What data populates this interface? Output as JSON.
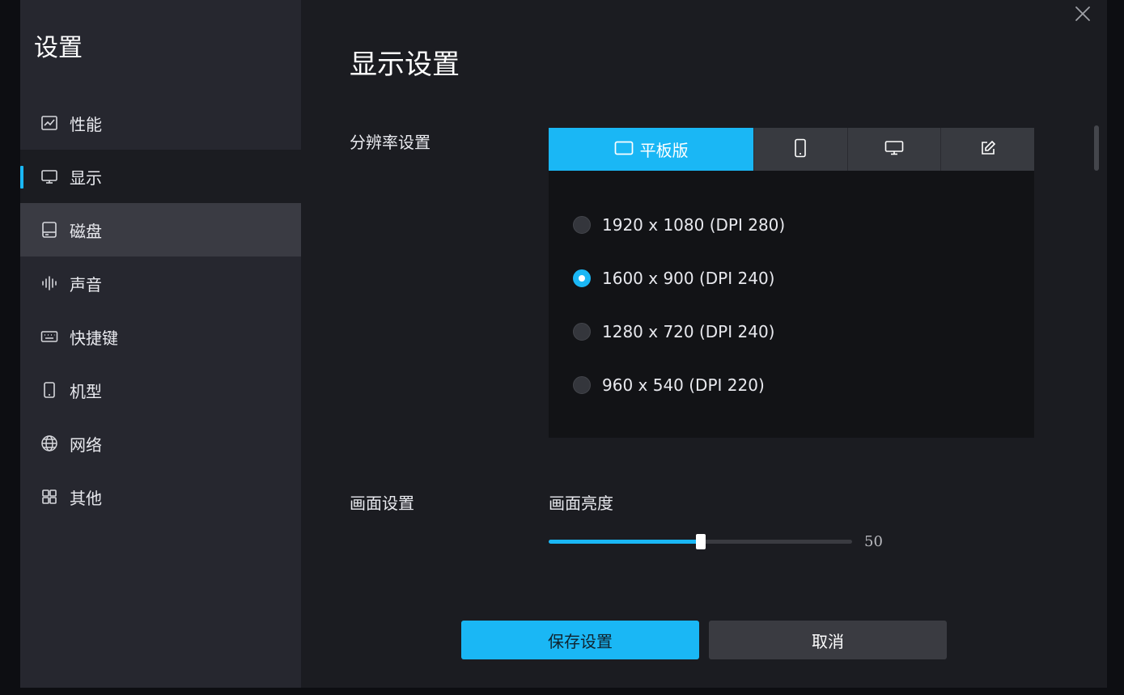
{
  "sidebar": {
    "title": "设置",
    "items": [
      {
        "label": "性能",
        "icon": "chart-line-icon",
        "state": "normal"
      },
      {
        "label": "显示",
        "icon": "monitor-icon",
        "state": "active"
      },
      {
        "label": "磁盘",
        "icon": "disk-icon",
        "state": "hover"
      },
      {
        "label": "声音",
        "icon": "sound-wave-icon",
        "state": "normal"
      },
      {
        "label": "快捷键",
        "icon": "keyboard-icon",
        "state": "normal"
      },
      {
        "label": "机型",
        "icon": "phone-icon",
        "state": "normal"
      },
      {
        "label": "网络",
        "icon": "globe-icon",
        "state": "normal"
      },
      {
        "label": "其他",
        "icon": "grid-icon",
        "state": "normal"
      }
    ]
  },
  "main": {
    "title": "显示设置",
    "resolution": {
      "label": "分辨率设置",
      "tabs": [
        {
          "label": "平板版",
          "icon": "tablet-icon",
          "selected": true
        },
        {
          "label": "",
          "icon": "phone-icon",
          "selected": false
        },
        {
          "label": "",
          "icon": "desktop-icon",
          "selected": false
        },
        {
          "label": "",
          "icon": "edit-icon",
          "selected": false
        }
      ],
      "options": [
        {
          "label": "1920 x 1080 (DPI 280)",
          "checked": false
        },
        {
          "label": "1600 x 900 (DPI 240)",
          "checked": true
        },
        {
          "label": "1280 x 720 (DPI 240)",
          "checked": false
        },
        {
          "label": "960 x 540 (DPI 220)",
          "checked": false
        }
      ]
    },
    "picture": {
      "label": "画面设置",
      "brightness_label": "画面亮度",
      "brightness_value": "50",
      "brightness_percent": 50
    }
  },
  "actions": {
    "save_label": "保存设置",
    "cancel_label": "取消"
  },
  "colors": {
    "accent": "#1ab7f5",
    "sidebar_bg": "#26272f",
    "main_bg": "#1b1c21"
  }
}
